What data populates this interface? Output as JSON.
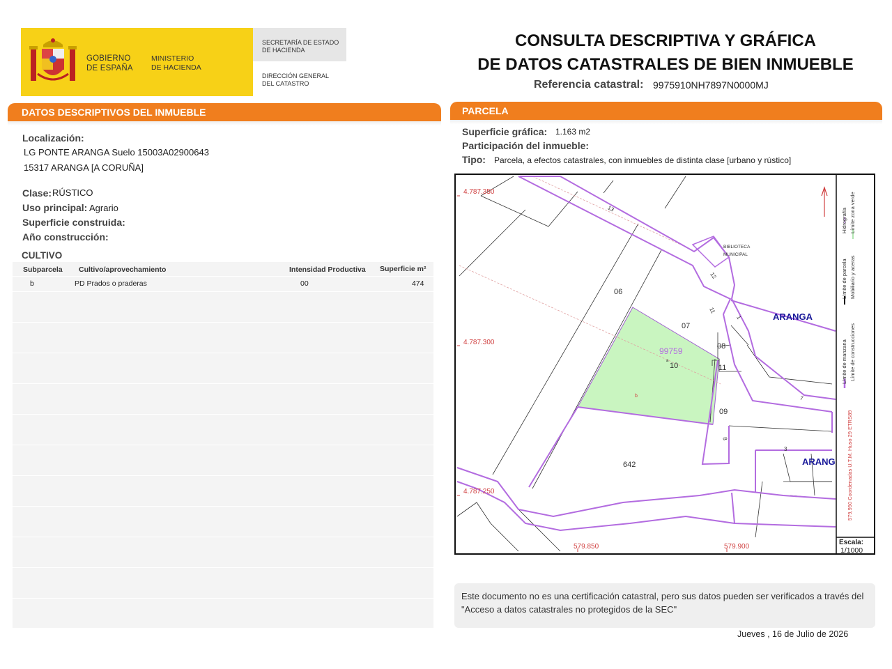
{
  "header": {
    "gov_line1": "GOBIERNO",
    "gov_line2": "DE ESPAÑA",
    "min_line1": "MINISTERIO",
    "min_line2": "DE HACIENDA",
    "sec_line1": "SECRETARÍA DE ESTADO",
    "sec_line2": "DE HACIENDA",
    "dg_line1": "DIRECCIÓN GENERAL",
    "dg_line2": "DEL CATASTRO",
    "brand_color": "#f7d117"
  },
  "title": {
    "line1": "CONSULTA DESCRIPTIVA Y GRÁFICA",
    "line2": "DE DATOS CATASTRALES DE BIEN INMUEBLE",
    "ref_label": "Referencia catastral:",
    "ref_value": "9975910NH7897N0000MJ"
  },
  "left": {
    "section_title": "DATOS DESCRIPTIVOS DEL INMUEBLE",
    "localizacion_label": "Localización:",
    "localizacion_line1": "LG PONTE ARANGA  Suelo 15003A02900643",
    "localizacion_line2": "15317 ARANGA [A CORUÑA]",
    "clase_label": "Clase:",
    "clase_value": "RÚSTICO",
    "uso_label": "Uso principal:",
    "uso_value": "Agrario",
    "superficie_label": "Superficie construida:",
    "anio_label": "Año construcción:",
    "cultivo_title": "CULTIVO",
    "table": {
      "headers": [
        "Subparcela",
        "Cultivo/aprovechamiento",
        "Intensidad Productiva",
        "Superficie m²"
      ],
      "rows": [
        {
          "subparcela": "b",
          "cultivo": "PD Prados o praderas",
          "intensidad": "00",
          "superficie": "474"
        }
      ]
    }
  },
  "right": {
    "section_title": "PARCELA",
    "superficie_label": "Superficie gráfica:",
    "superficie_value": "1.163 m2",
    "participacion_label": "Participación del inmueble:",
    "tipo_label": "Tipo:",
    "tipo_value": "Parcela, a efectos catastrales, con inmuebles de distinta clase [urbano y rústico]"
  },
  "map": {
    "y_labels": [
      "4.787.350",
      "4.787.300",
      "4.787.250"
    ],
    "x_labels": [
      "579.850",
      "579.900"
    ],
    "parcel_labels": [
      "06",
      "07",
      "08",
      "11",
      "09",
      "642",
      "10"
    ],
    "road_numbers": [
      "13",
      "12",
      "11",
      "1",
      "7",
      "8",
      "3"
    ],
    "highlight_label": "99759",
    "subparcel_label": "b",
    "subparcel_a": "a",
    "place_name": "ARANGA",
    "place_name_cut": "ARANG",
    "building_line1": "BIBLIOTECA",
    "building_line2": "MUNICIPAL",
    "legend": {
      "limite_manzana": "Límite de manzana",
      "limite_parcela": "Límite de parcela",
      "limite_construcciones": "Límite de construcciones",
      "mobiliario": "Mobiliario y aceras",
      "limite_zona_verde": "Límite zona verde",
      "hidrografia": "Hidrografía"
    },
    "coords_note": "579,950 Coordenadas U.T.M. Huso 29 ETRS89",
    "scale_label": "Escala:",
    "scale_value": "1/1000",
    "colors": {
      "parcel_line": "#b36ce0",
      "highlight": "#c9f5c0",
      "coord": "#d04040",
      "place": "#1a1a9a"
    }
  },
  "footer": {
    "note": "Este documento no es una certificación catastral, pero sus datos pueden ser verificados a través del \"Acceso a datos catastrales no protegidos de la SEC\"",
    "date": "Jueves , 16 de Julio de 2026"
  }
}
